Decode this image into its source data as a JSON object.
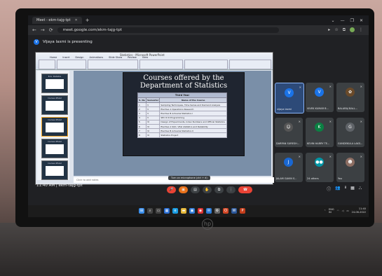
{
  "browser": {
    "tab_title": "Meet - ekm-tajg-tpt",
    "tab_close": "✕",
    "new_tab": "+",
    "url": "meet.google.com/ekm-tajg-tpt",
    "window_controls": [
      "⌄",
      "—",
      "❐",
      "✕"
    ]
  },
  "meet": {
    "presenting_text": "Vijaya laxmi is presenting",
    "presenter_initial": "V",
    "time_and_code": "11:40 AM  |  ekm-tajg-tpt",
    "mic_tooltip": "Turn on microphone (ctrl + d)",
    "controls": [
      {
        "name": "mic-off-button",
        "glyph": "🎤",
        "style": "red"
      },
      {
        "name": "camera-off-button",
        "glyph": "▣",
        "style": "orange"
      },
      {
        "name": "captions-button",
        "glyph": "▤",
        "style": ""
      },
      {
        "name": "raise-hand-button",
        "glyph": "✋",
        "style": ""
      },
      {
        "name": "present-button",
        "glyph": "⧉",
        "style": ""
      },
      {
        "name": "more-options-button",
        "glyph": "⋮",
        "style": ""
      },
      {
        "name": "end-call-button",
        "glyph": "☎",
        "style": "end"
      }
    ],
    "right_controls": [
      {
        "name": "info-icon",
        "glyph": "ⓘ"
      },
      {
        "name": "people-icon",
        "glyph": "👥"
      },
      {
        "name": "chat-icon",
        "glyph": "▦"
      },
      {
        "name": "activities-icon",
        "glyph": "⛬"
      }
    ],
    "participant_count": "8"
  },
  "participants": [
    {
      "name": "vijaya laxmi",
      "initial": "V",
      "color": "#1a73e8",
      "active": true
    },
    {
      "name": "VIVEK KUMAR B...",
      "initial": "V",
      "color": "#1a73e8",
      "active": false
    },
    {
      "name": "BALARAJ BALL...",
      "initial": "✿",
      "color": "#6a4a2a",
      "active": false
    },
    {
      "name": "DARPAN SURESH...",
      "initial": "☺",
      "color": "#555",
      "active": false
    },
    {
      "name": "KEVIN HARRY TE...",
      "initial": "K",
      "color": "#0b8043",
      "active": false
    },
    {
      "name": "GUNDEKULA LAKS...",
      "initial": "G",
      "color": "#5f6368",
      "active": false
    },
    {
      "name": "JALAM GAVIN S...",
      "initial": "J",
      "color": "#1967d2",
      "active": false
    },
    {
      "name": "24 others",
      "initial": "●●",
      "color": "#0097a7",
      "active": false
    },
    {
      "name": "You",
      "initial": "☻",
      "color": "#8d6e63",
      "active": false
    }
  ],
  "presentation": {
    "window_title": "Statistics - Microsoft PowerPoint",
    "ribbon_tabs": [
      "Home",
      "Insert",
      "Design",
      "Animations",
      "Slide Show",
      "Review",
      "View"
    ],
    "slide_title": "Courses offered by the Department of Statistics",
    "table_caption": "Third Year",
    "table_headers": [
      "S. No",
      "Semester",
      "Name of the Course"
    ],
    "table_rows": [
      [
        "1",
        "V",
        "Sampling Techniques, Time Series and Demand Analysis"
      ],
      [
        "2",
        "V",
        "Elective A   Operations Research"
      ],
      [
        "3",
        "V",
        "Elective B   Actuarial Statistics I"
      ],
      [
        "4",
        "V",
        "SEC  III   R  Programming"
      ],
      [
        "5",
        "VI",
        "Design of Experiments, Index Numbers and Official Statistics"
      ],
      [
        "6",
        "VI",
        "Elective A   SQC, Vital statistics and Reliability"
      ],
      [
        "7",
        "VI",
        "Elective B   Actuarial Statistics II"
      ],
      [
        "8",
        "VI",
        "Statistics Project"
      ]
    ],
    "notes_placeholder": "Click to add notes",
    "thumbnails": [
      "B.Sc. Statistics",
      "Courses offered",
      "Courses offered",
      "Courses offered",
      "Courses offered"
    ]
  },
  "taskbar": {
    "icons": [
      {
        "name": "windows-start-icon",
        "glyph": "⊞",
        "color": "#3b8eea"
      },
      {
        "name": "search-icon",
        "glyph": "⌕",
        "color": "#444"
      },
      {
        "name": "task-view-icon",
        "glyph": "▭",
        "color": "#444"
      },
      {
        "name": "widgets-icon",
        "glyph": "▦",
        "color": "#2a6fd6"
      },
      {
        "name": "edge-icon",
        "glyph": "e",
        "color": "#1b9de2"
      },
      {
        "name": "file-explorer-icon",
        "glyph": "▬",
        "color": "#e6b83a"
      },
      {
        "name": "store-icon",
        "glyph": "▣",
        "color": "#2f7bd8"
      },
      {
        "name": "chrome-icon",
        "glyph": "◉",
        "color": "#d33"
      },
      {
        "name": "mail-icon",
        "glyph": "✉",
        "color": "#2a7ad6"
      },
      {
        "name": "settings-icon",
        "glyph": "⚙",
        "color": "#666"
      },
      {
        "name": "office-icon",
        "glyph": "O",
        "color": "#d24726"
      },
      {
        "name": "word-icon",
        "glyph": "W",
        "color": "#2b579a"
      },
      {
        "name": "powerpoint-icon",
        "glyph": "P",
        "color": "#c43e1c"
      }
    ],
    "lang": "ENG",
    "region": "IN",
    "time": "11:40",
    "date": "24-06-2022"
  }
}
